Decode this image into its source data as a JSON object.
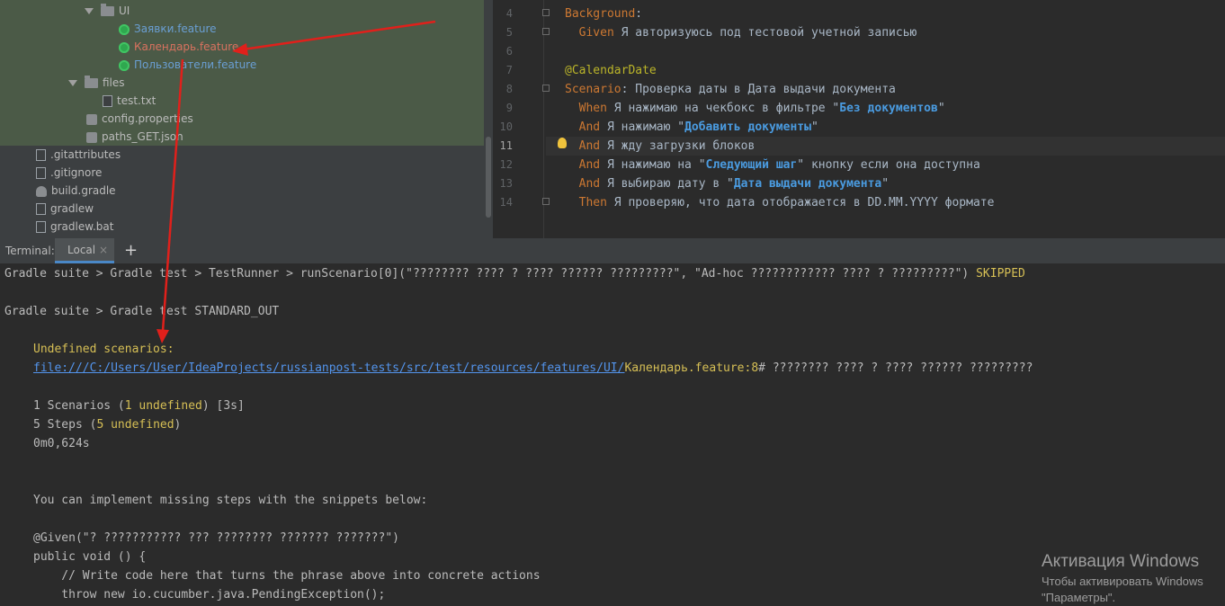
{
  "tree": {
    "items": [
      {
        "label": "UI",
        "kind": "folder"
      },
      {
        "label": "Заявки.feature",
        "kind": "cucumber"
      },
      {
        "label": "Календарь.feature",
        "kind": "cucumber"
      },
      {
        "label": "Пользователи.feature",
        "kind": "cucumber"
      },
      {
        "label": "files",
        "kind": "folder"
      },
      {
        "label": "test.txt",
        "kind": "file"
      },
      {
        "label": "config.properties",
        "kind": "file"
      },
      {
        "label": "paths_GET.json",
        "kind": "file"
      },
      {
        "label": ".gitattributes",
        "kind": "file"
      },
      {
        "label": ".gitignore",
        "kind": "file"
      },
      {
        "label": "build.gradle",
        "kind": "gradle"
      },
      {
        "label": "gradlew",
        "kind": "script"
      },
      {
        "label": "gradlew.bat",
        "kind": "script"
      }
    ]
  },
  "editor": {
    "line_numbers": [
      "4",
      "5",
      "6",
      "7",
      "8",
      "9",
      "10",
      "11",
      "12",
      "13",
      "14"
    ],
    "lines": {
      "l4_kw": "Background",
      "l4_rest": ":",
      "l5_kw": "Given",
      "l5_rest": " Я авторизуюсь под тестовой учетной записью",
      "l7_tag": "@CalendarDate",
      "l8_kw": "Scenario",
      "l8_rest": ": Проверка даты в Дата выдачи документа",
      "l9_kw": "When",
      "l9_a": " Я нажимаю на чекбокс в фильтре \"",
      "l9_p": "Без документов",
      "l9_b": "\"",
      "l10_kw": "And",
      "l10_a": " Я нажимаю \"",
      "l10_p": "Добавить документы",
      "l10_b": "\"",
      "l11_kw": "And",
      "l11_rest": " Я жду загрузки блоков",
      "l12_kw": "And",
      "l12_a": " Я нажимаю на \"",
      "l12_p": "Следующий шаг",
      "l12_b": "\" кнопку если она доступна",
      "l13_kw": "And",
      "l13_a": " Я выбираю дату в \"",
      "l13_p": "Дата выдачи документа",
      "l13_b": "\"",
      "l14_kw": "Then",
      "l14_rest": " Я проверяю, что дата отображается в DD.MM.YYYY формате"
    }
  },
  "terminal": {
    "label": "Terminal:",
    "tab": "Local",
    "tab_close": "×",
    "new_tab": "+",
    "lines": {
      "run_a": "Gradle suite > Gradle test > TestRunner > runScenario[0](\"???????? ???? ? ???? ?????? ?????????\", \"Ad-hoc ???????????? ???? ? ?????????\") ",
      "run_status": "SKIPPED",
      "stdout": "Gradle suite > Gradle test STANDARD_OUT",
      "undef_header": "Undefined scenarios:",
      "link": "file:///C:/Users/User/IdeaProjects/russianpost-tests/src/test/resources/features/UI/",
      "link_file": "Календарь.feature:8",
      "link_rest": "# ???????? ???? ? ???? ?????? ?????????",
      "scen_a": "1 Scenarios (",
      "scen_y": "1 undefined",
      "scen_b": ") [3s]",
      "steps_a": "5 Steps (",
      "steps_y": "5 undefined",
      "steps_b": ")",
      "time": "0m0,624s",
      "impl": "You can implement missing steps with the snippets below:",
      "given": "@Given(\"? ??????????? ??? ???????? ??????? ???????\")",
      "pubvoid": "public void () {",
      "comment": "    // Write code here that turns the phrase above into concrete actions",
      "throw": "    throw new io.cucumber.java.PendingException();"
    }
  },
  "watermark": {
    "title": "Активация Windows",
    "subtitle": "Чтобы активировать Windows",
    "subtitle2": "\"Параметры\"."
  },
  "colors": {
    "arrow": "#e0201b",
    "selection": "#4b5a47",
    "keyword": "#cc7832",
    "param": "#4a9be0"
  }
}
